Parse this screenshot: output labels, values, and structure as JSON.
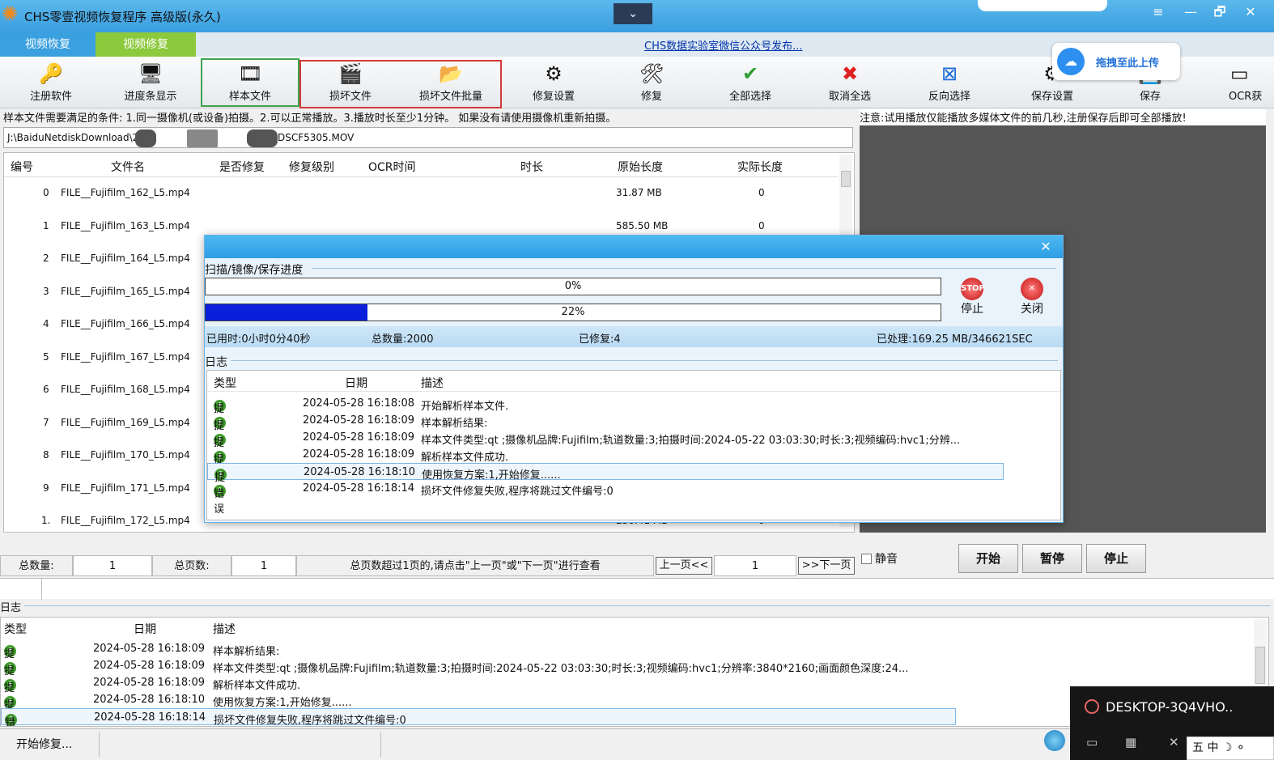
{
  "window": {
    "title": "CHS零壹视频恢复程序 高级版(永久)",
    "collapse_glyph": "⌄",
    "buttons": {
      "menu": "≡",
      "minimize": "—",
      "restore": "🗗",
      "close": "✕"
    }
  },
  "tabs": [
    {
      "label": "视频恢复"
    },
    {
      "label": "视频修复"
    }
  ],
  "weixin_link": "CHS数据实验室微信公众号发布...",
  "toolbar": [
    {
      "label": "注册软件",
      "icon": "🔑"
    },
    {
      "label": "进度条显示",
      "icon": "🖥"
    },
    {
      "label": "样本文件",
      "icon": "🎞"
    },
    {
      "label": "损坏文件",
      "icon": "🎬"
    },
    {
      "label": "损坏文件批量",
      "icon": "📂"
    },
    {
      "label": "修复设置",
      "icon": "⚙"
    },
    {
      "label": "修复",
      "icon": "🛠"
    },
    {
      "label": "全部选择",
      "icon": "✔"
    },
    {
      "label": "取消全选",
      "icon": "✖"
    },
    {
      "label": "反向选择",
      "icon": "⊠"
    },
    {
      "label": "保存设置",
      "icon": "⚙"
    },
    {
      "label": "保存",
      "icon": "💾"
    },
    {
      "label": "OCR获",
      "icon": "▭"
    }
  ],
  "drag_upload": {
    "label": "拖拽至此上传",
    "icon": "☁"
  },
  "requirements": "样本文件需要满足的条件: 1.同一摄像机(或设备)拍摄。2.可以正常播放。3.播放时长至少1分钟。 如果没有请使用摄像机重新拍摄。",
  "path": {
    "prefix": "J:\\BaiduNetdiskDownload\\2",
    "suffix": "DSCF5305.MOV"
  },
  "file_table": {
    "headers": [
      "编号",
      "文件名",
      "是否修复",
      "修复级别",
      "OCR时间",
      "时长",
      "原始长度",
      "实际长度"
    ],
    "rows": [
      {
        "id": "0",
        "name": "FILE__Fujifilm_162_L5.mp4",
        "orig": "31.87 MB",
        "actual": "0"
      },
      {
        "id": "1",
        "name": "FILE__Fujifilm_163_L5.mp4",
        "orig": "585.50 MB",
        "actual": "0"
      },
      {
        "id": "2",
        "name": "FILE__Fujifilm_164_L5.mp4",
        "orig": "",
        "actual": ""
      },
      {
        "id": "3",
        "name": "FILE__Fujifilm_165_L5.mp4",
        "orig": "",
        "actual": ""
      },
      {
        "id": "4",
        "name": "FILE__Fujifilm_166_L5.mp4",
        "orig": "",
        "actual": ""
      },
      {
        "id": "5",
        "name": "FILE__Fujifilm_167_L5.mp4",
        "orig": "",
        "actual": ""
      },
      {
        "id": "6",
        "name": "FILE__Fujifilm_168_L5.mp4",
        "orig": "",
        "actual": ""
      },
      {
        "id": "7",
        "name": "FILE__Fujifilm_169_L5.mp4",
        "orig": "",
        "actual": ""
      },
      {
        "id": "8",
        "name": "FILE__Fujifilm_170_L5.mp4",
        "orig": "",
        "actual": ""
      },
      {
        "id": "9",
        "name": "FILE__Fujifilm_171_L5.mp4",
        "orig": "",
        "actual": ""
      },
      {
        "id": "1.",
        "name": "FILE__Fujifilm_172_L5.mp4",
        "orig": "250.41 MB",
        "actual": "0"
      }
    ]
  },
  "preview": {
    "note": "注意:试用播放仅能播放多媒体文件的前几秒,注册保存后即可全部播放!",
    "mute_label": "静音",
    "buttons": [
      "开始",
      "暂停",
      "停止"
    ]
  },
  "pager": {
    "total_count_label": "总数量:",
    "total_count": "1",
    "total_pages_label": "总页数:",
    "total_pages": "1",
    "hint": "总页数超过1页的,请点击\"上一页\"或\"下一页\"进行查看",
    "prev": "上一页<<",
    "page": "1",
    "next": ">>下一页"
  },
  "log": {
    "title": "日志",
    "headers": [
      "类型",
      "日期",
      "描述"
    ],
    "rows": [
      {
        "type": "提示",
        "date": "2024-05-28 16:18:09",
        "desc": "样本解析结果:"
      },
      {
        "type": "提示",
        "date": "2024-05-28 16:18:09",
        "desc": "样本文件类型:qt ;摄像机品牌:Fujifilm;轨道数量:3;拍摄时间:2024-05-22 03:03:30;时长:3;视频编码:hvc1;分辨率:3840*2160;画面颜色深度:24..."
      },
      {
        "type": "提示",
        "date": "2024-05-28 16:18:09",
        "desc": "解析样本文件成功."
      },
      {
        "type": "提示",
        "date": "2024-05-28 16:18:10",
        "desc": "使用恢复方案:1,开始修复......"
      },
      {
        "type": "错误",
        "date": "2024-05-28 16:18:14",
        "desc": "损坏文件修复失败,程序将跳过文件编号:0"
      }
    ]
  },
  "status": {
    "message": "开始修复..."
  },
  "desktop": {
    "name": "DESKTOP-3Q4VHO..",
    "ime": "五 中 ☽ ⚬"
  },
  "dialog": {
    "progress_label": "扫描/镜像/保存进度",
    "bar1": {
      "percent": 0,
      "text": "0%"
    },
    "bar2": {
      "percent": 22,
      "text": "22%"
    },
    "stop_label": "停止",
    "stop_icon_text": "STOP",
    "close_label": "关闭",
    "close_icon_text": "✕",
    "close_glyph": "✕",
    "elapsed": "已用时:0小时0分40秒",
    "total": "总数量:2000",
    "repaired": "已修复:4",
    "processed": "已处理:169.25 MB/346621SEC",
    "log_title": "日志",
    "log_headers": [
      "类型",
      "日期",
      "描述"
    ],
    "log_rows": [
      {
        "type": "提示",
        "date": "2024-05-28 16:18:08",
        "desc": "开始解析样本文件."
      },
      {
        "type": "提示",
        "date": "2024-05-28 16:18:09",
        "desc": "样本解析结果:"
      },
      {
        "type": "提示",
        "date": "2024-05-28 16:18:09",
        "desc": "样本文件类型:qt ;摄像机品牌:Fujifilm;轨道数量:3;拍摄时间:2024-05-22 03:03:30;时长:3;视频编码:hvc1;分辨..."
      },
      {
        "type": "提示",
        "date": "2024-05-28 16:18:09",
        "desc": "解析样本文件成功."
      },
      {
        "type": "提示",
        "date": "2024-05-28 16:18:10",
        "desc": "使用恢复方案:1,开始修复......"
      },
      {
        "type": "错误",
        "date": "2024-05-28 16:18:14",
        "desc": "损坏文件修复失败,程序将跳过文件编号:0"
      }
    ]
  }
}
